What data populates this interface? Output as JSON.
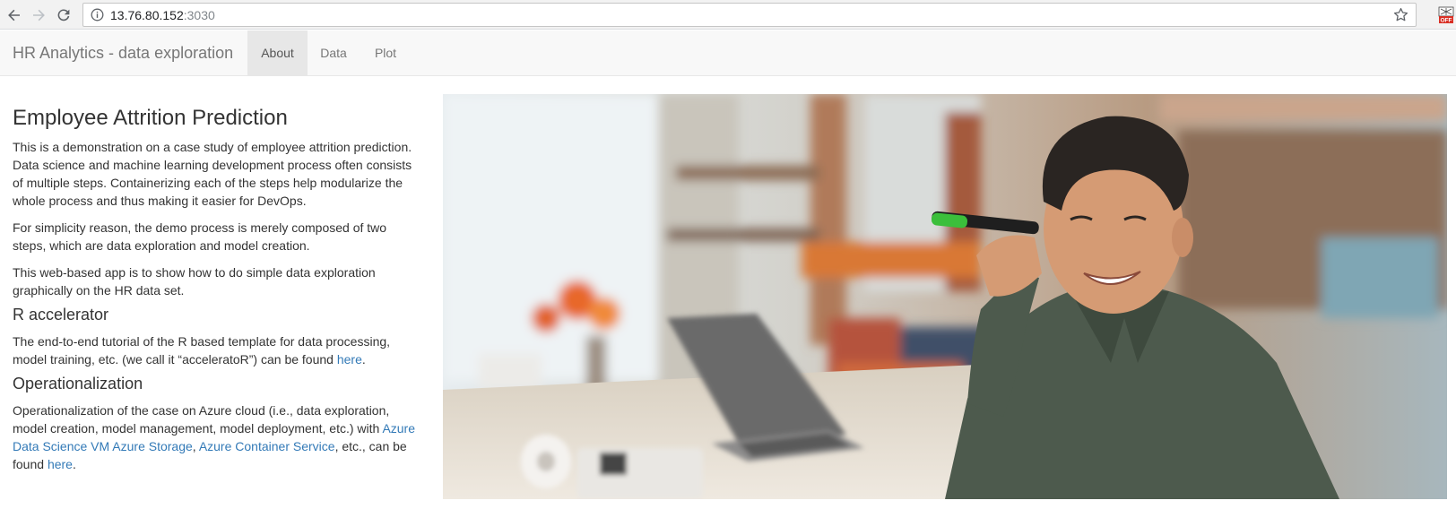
{
  "browser": {
    "url_host": "13.76.80.152",
    "url_port": ":3030",
    "icons": [
      "back-arrow-icon",
      "forward-arrow-icon",
      "reload-icon",
      "info-icon",
      "bookmark-star-icon",
      "extension-off-icon"
    ]
  },
  "navbar": {
    "brand": "HR Analytics - data exploration",
    "tabs": [
      {
        "label": "About",
        "active": true
      },
      {
        "label": "Data",
        "active": false
      },
      {
        "label": "Plot",
        "active": false
      }
    ]
  },
  "content": {
    "title": "Employee Attrition Prediction",
    "intro_p1": "This is a demonstration on a case study of employee attrition prediction. Data science and machine learning development process often consists of multiple steps. Containerizing each of the steps help modularize the whole process and thus making it easier for DevOps.",
    "intro_p2": "For simplicity reason, the demo process is merely composed of two steps, which are data exploration and model creation.",
    "intro_p3": "This web-based app is to show how to do simple data exploration graphically on the HR data set.",
    "section1": {
      "heading": "R accelerator",
      "text_before": "The end-to-end tutorial of the R based template for data processing, model training, etc. (we call it “acceleratoR”) can be found ",
      "link": "here",
      "text_after": "."
    },
    "section2": {
      "heading": "Operationalization",
      "text_before": "Operationalization of the case on Azure cloud (i.e., data exploration, model creation, model management, model deployment, etc.) with ",
      "link1": "Azure Data Science VM",
      "sep1": " ",
      "link2": "Azure Storage",
      "sep2": ", ",
      "link3": "Azure Container Service",
      "text_mid": ", etc., can be found ",
      "link4": "here",
      "text_after": "."
    }
  },
  "colors": {
    "link": "#337ab7",
    "navbar_bg": "#f8f8f8",
    "active_tab_bg": "#e7e7e7"
  }
}
